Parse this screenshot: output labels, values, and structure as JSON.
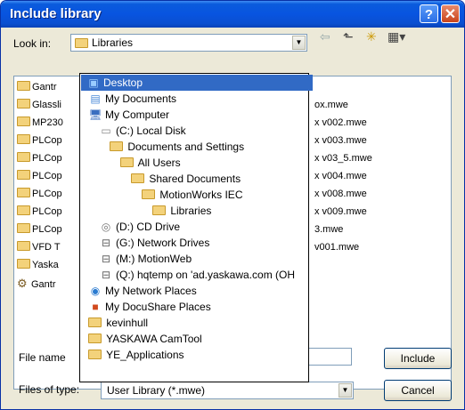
{
  "window": {
    "title": "Include library",
    "help": "?",
    "close": "✕"
  },
  "look_in": {
    "label": "Look in:",
    "value": "Libraries"
  },
  "toolbar": {
    "back": "⇦",
    "up": "⬑",
    "new_folder": "✳",
    "views": "▦▾"
  },
  "file_list": [
    {
      "name": "Gantr",
      "right": ""
    },
    {
      "name": "Glassli",
      "right": "ox.mwe"
    },
    {
      "name": "MP230",
      "right": "x v002.mwe"
    },
    {
      "name": "PLCop",
      "right": "x v003.mwe"
    },
    {
      "name": "PLCop",
      "right": "x v03_5.mwe"
    },
    {
      "name": "PLCop",
      "right": "x v004.mwe"
    },
    {
      "name": "PLCop",
      "right": "x v008.mwe"
    },
    {
      "name": "PLCop",
      "right": "x v009.mwe"
    },
    {
      "name": "PLCop",
      "right": "3.mwe"
    },
    {
      "name": "VFD T",
      "right": "v001.mwe"
    },
    {
      "name": "Yaska",
      "right": ""
    },
    {
      "name": "Gantr",
      "right": ""
    }
  ],
  "dropdown": [
    {
      "label": "Desktop",
      "icon": "desktop-icon",
      "indent": 0
    },
    {
      "label": "My Documents",
      "icon": "my-documents-icon",
      "indent": 1
    },
    {
      "label": "My Computer",
      "icon": "my-computer-icon",
      "indent": 1
    },
    {
      "label": "(C:) Local Disk",
      "icon": "local-disk-icon",
      "indent": 2
    },
    {
      "label": "Documents and Settings",
      "icon": "folder-icon",
      "indent": 3
    },
    {
      "label": "All Users",
      "icon": "folder-icon",
      "indent": 4
    },
    {
      "label": "Shared Documents",
      "icon": "folder-icon",
      "indent": 5
    },
    {
      "label": "MotionWorks IEC",
      "icon": "folder-icon",
      "indent": 6
    },
    {
      "label": "Libraries",
      "icon": "folder-open-icon",
      "indent": 7
    },
    {
      "label": "(D:) CD Drive",
      "icon": "cd-drive-icon",
      "indent": 2
    },
    {
      "label": "(G:) Network Drives",
      "icon": "network-drive-icon",
      "indent": 2
    },
    {
      "label": "(M:) MotionWeb",
      "icon": "network-drive-icon",
      "indent": 2
    },
    {
      "label": "(Q:) hqtemp on 'ad.yaskawa.com (OH",
      "icon": "network-drive-icon",
      "indent": 2
    },
    {
      "label": "My Network Places",
      "icon": "network-places-icon",
      "indent": 1
    },
    {
      "label": "My DocuShare Places",
      "icon": "docushare-icon",
      "indent": 1
    },
    {
      "label": "kevinhull",
      "icon": "folder-icon",
      "indent": 1
    },
    {
      "label": "YASKAWA CamTool",
      "icon": "folder-icon",
      "indent": 1
    },
    {
      "label": "YE_Applications",
      "icon": "folder-icon",
      "indent": 1
    }
  ],
  "file_name": {
    "label": "File name",
    "value": ""
  },
  "files_of_type": {
    "label": "Files of type:",
    "value": "User Library (*.mwe)"
  },
  "buttons": {
    "include": "Include",
    "cancel": "Cancel"
  }
}
